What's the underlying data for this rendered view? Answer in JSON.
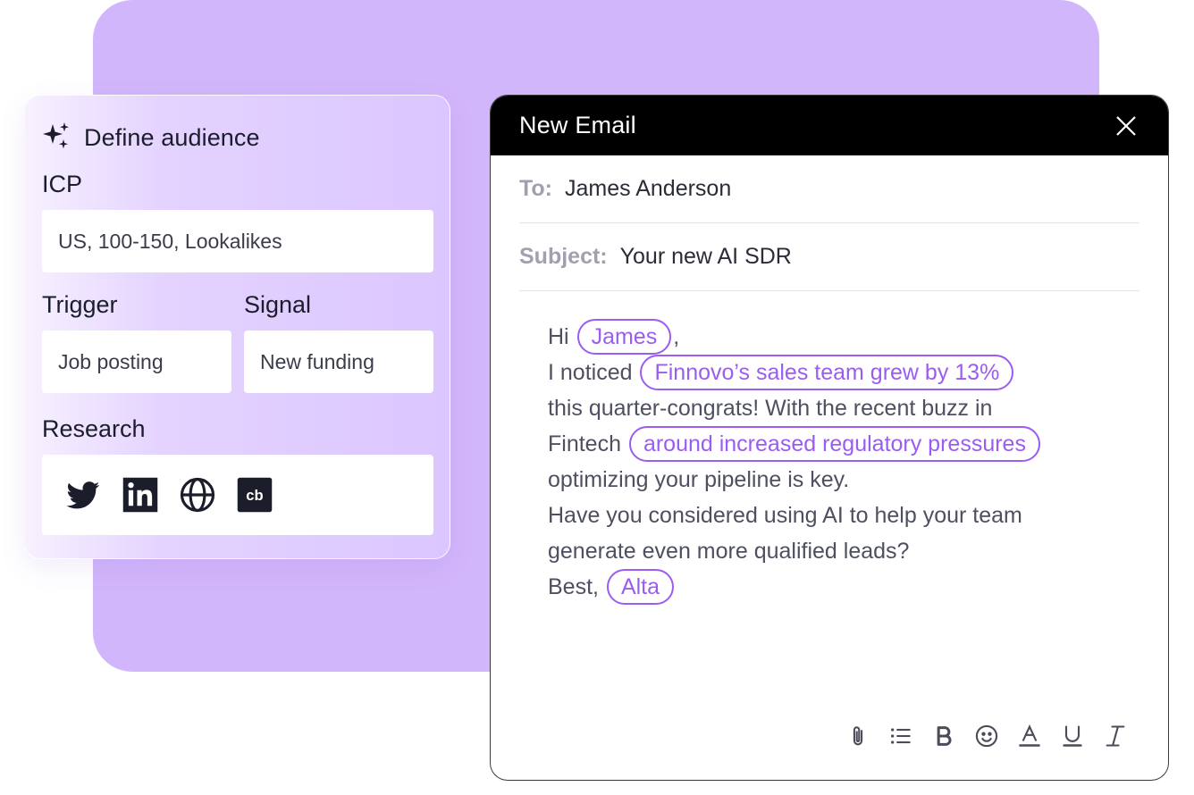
{
  "audience": {
    "title": "Define audience",
    "title_icon": "sparkles-icon",
    "icp_label": "ICP",
    "icp_value": "US, 100-150, Lookalikes",
    "trigger_label": "Trigger",
    "trigger_value": "Job posting",
    "signal_label": "Signal",
    "signal_value": "New funding",
    "research_label": "Research",
    "research_sources": [
      "twitter-icon",
      "linkedin-icon",
      "globe-icon",
      "crunchbase-icon"
    ],
    "crunchbase_text": "cb"
  },
  "email": {
    "title": "New Email",
    "to_label": "To:",
    "to_value": "James Anderson",
    "subject_label": "Subject:",
    "subject_value": "Your new AI SDR",
    "greeting_prefix": "Hi",
    "greeting_name": "James",
    "greeting_suffix": ",",
    "p1_prefix": "I noticed",
    "p1_highlight1": "Finnovo’s sales team grew by 13%",
    "p1_line2": "this quarter-congrats! With the recent buzz in",
    "p1_line3_prefix": "Fintech",
    "p1_highlight2": "around increased regulatory pressures",
    "p1_line4": "optimizing your pipeline is key.",
    "p2_line1": "Have you considered using AI to help your team",
    "p2_line2": "generate even more qualified leads?",
    "signoff": "Best,",
    "sender": "Alta",
    "toolbar": [
      "attach-icon",
      "bullet-list-icon",
      "bold-icon",
      "emoji-icon",
      "text-color-icon",
      "underline-icon",
      "italic-icon"
    ]
  },
  "colors": {
    "background_blob": "#d2b6fb",
    "accent": "#9b5cf1",
    "header": "#000000"
  }
}
